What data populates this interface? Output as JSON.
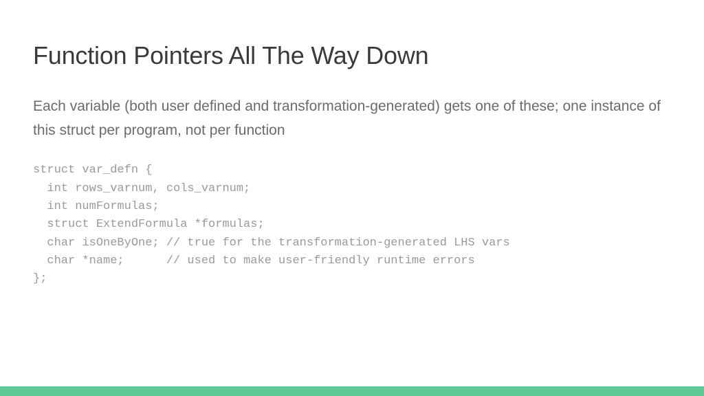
{
  "title": "Function Pointers All The Way Down",
  "description": "Each variable (both user defined and transformation-generated) gets one of these; one instance of this struct per program, not per function",
  "code": "struct var_defn {\n  int rows_varnum, cols_varnum;\n  int numFormulas;\n  struct ExtendFormula *formulas;\n  char isOneByOne; // true for the transformation-generated LHS vars\n  char *name;      // used to make user-friendly runtime errors\n};",
  "accent_color": "#5ec997"
}
